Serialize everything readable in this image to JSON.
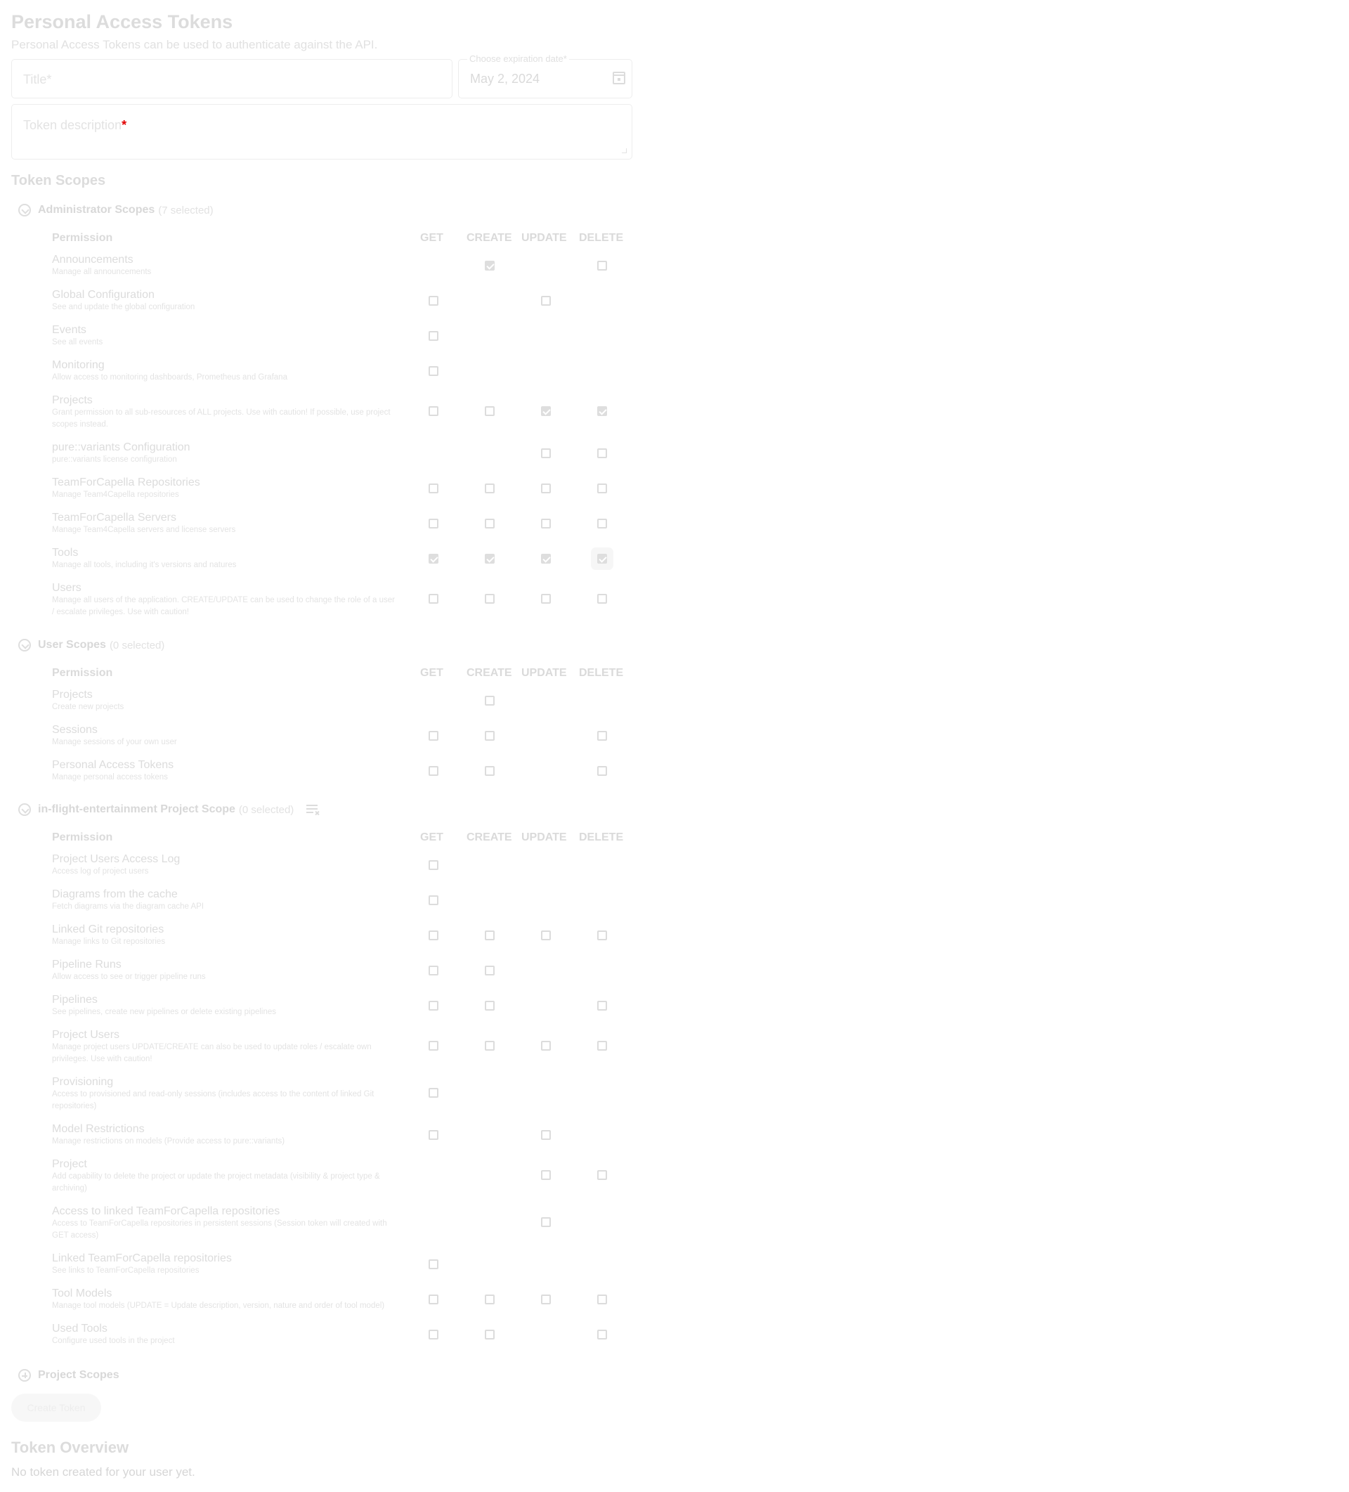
{
  "page": {
    "title": "Personal Access Tokens",
    "subtitle": "Personal Access Tokens can be used to authenticate against the API."
  },
  "form": {
    "title_placeholder": "Title*",
    "expiration_label": "Choose expiration date*",
    "expiration_value": "May 2, 2024",
    "description_placeholder": "Token description",
    "description_required_mark": "*"
  },
  "scopes": {
    "section_title": "Token Scopes",
    "columns": [
      "Permission",
      "GET",
      "CREATE",
      "UPDATE",
      "DELETE"
    ],
    "groups": [
      {
        "name": "Administrator Scopes",
        "count": "(7 selected)",
        "rows": [
          {
            "name": "Announcements",
            "desc": "Manage all announcements",
            "perms": [
              null,
              true,
              null,
              false
            ]
          },
          {
            "name": "Global Configuration",
            "desc": "See and update the global configuration",
            "perms": [
              false,
              null,
              false,
              null
            ]
          },
          {
            "name": "Events",
            "desc": "See all events",
            "perms": [
              false,
              null,
              null,
              null
            ]
          },
          {
            "name": "Monitoring",
            "desc": "Allow access to monitoring dashboards, Prometheus and Grafana",
            "perms": [
              false,
              null,
              null,
              null
            ]
          },
          {
            "name": "Projects",
            "desc": "Grant permission to all sub-resources of ALL projects. Use with caution! If possible, use project scopes instead.",
            "perms": [
              false,
              false,
              true,
              true
            ]
          },
          {
            "name": "pure::variants Configuration",
            "desc": "pure::variants license configuration",
            "perms": [
              null,
              null,
              false,
              false
            ]
          },
          {
            "name": "TeamForCapella Repositories",
            "desc": "Manage Team4Capella repositories",
            "perms": [
              false,
              false,
              false,
              false
            ]
          },
          {
            "name": "TeamForCapella Servers",
            "desc": "Manage Team4Capella servers and license servers",
            "perms": [
              false,
              false,
              false,
              false
            ]
          },
          {
            "name": "Tools",
            "desc": "Manage all tools, including it's versions and natures",
            "perms": [
              true,
              true,
              true,
              true
            ]
          },
          {
            "name": "Users",
            "desc": "Manage all users of the application. CREATE/UPDATE can be used to change the role of a user / escalate privileges. Use with caution!",
            "perms": [
              false,
              false,
              false,
              false
            ]
          }
        ]
      },
      {
        "name": "User Scopes",
        "count": "(0 selected)",
        "rows": [
          {
            "name": "Projects",
            "desc": "Create new projects",
            "perms": [
              null,
              false,
              null,
              null
            ]
          },
          {
            "name": "Sessions",
            "desc": "Manage sessions of your own user",
            "perms": [
              false,
              false,
              null,
              false
            ]
          },
          {
            "name": "Personal Access Tokens",
            "desc": "Manage personal access tokens",
            "perms": [
              false,
              false,
              null,
              false
            ]
          }
        ]
      },
      {
        "name": "in-flight-entertainment Project Scope",
        "count": "(0 selected)",
        "rows": [
          {
            "name": "Project Users Access Log",
            "desc": "Access log of project users",
            "perms": [
              false,
              null,
              null,
              null
            ]
          },
          {
            "name": "Diagrams from the cache",
            "desc": "Fetch diagrams via the diagram cache API",
            "perms": [
              false,
              null,
              null,
              null
            ]
          },
          {
            "name": "Linked Git repositories",
            "desc": "Manage links to Git repositories",
            "perms": [
              false,
              false,
              false,
              false
            ]
          },
          {
            "name": "Pipeline Runs",
            "desc": "Allow access to see or trigger pipeline runs",
            "perms": [
              false,
              false,
              null,
              null
            ]
          },
          {
            "name": "Pipelines",
            "desc": "See pipelines, create new pipelines or delete existing pipelines",
            "perms": [
              false,
              false,
              null,
              false
            ]
          },
          {
            "name": "Project Users",
            "desc": "Manage project users UPDATE/CREATE can also be used to update roles / escalate own privileges. Use with caution!",
            "perms": [
              false,
              false,
              false,
              false
            ]
          },
          {
            "name": "Provisioning",
            "desc": "Access to provisioned and read-only sessions (includes access to the content of linked Git repositories)",
            "perms": [
              false,
              null,
              null,
              null
            ]
          },
          {
            "name": "Model Restrictions",
            "desc": "Manage restrictions on models (Provide access to pure::variants)",
            "perms": [
              false,
              null,
              false,
              null
            ]
          },
          {
            "name": "Project",
            "desc": "Add capability to delete the project or update the project metadata (visibility & project type & archiving)",
            "perms": [
              null,
              null,
              false,
              false
            ]
          },
          {
            "name": "Access to linked TeamForCapella repositories",
            "desc": "Access to TeamForCapella repositories in persistent sessions (Session token will created with GET access)",
            "perms": [
              null,
              null,
              false,
              null
            ]
          },
          {
            "name": "Linked TeamForCapella repositories",
            "desc": "See links to TeamForCapella repositories",
            "perms": [
              false,
              null,
              null,
              null
            ]
          },
          {
            "name": "Tool Models",
            "desc": "Manage tool models (UPDATE = Update description, version, nature and order of tool model)",
            "perms": [
              false,
              false,
              false,
              false
            ]
          },
          {
            "name": "Used Tools",
            "desc": "Configure used tools in the project",
            "perms": [
              false,
              false,
              null,
              false
            ]
          }
        ]
      },
      {
        "name": "Project Scopes",
        "count": "",
        "rows": []
      }
    ]
  },
  "actions": {
    "create_button": "Create Token"
  },
  "overview": {
    "title": "Token Overview",
    "empty": "No token created for your user yet."
  },
  "icons": {
    "expand": "chevron-down-circle-icon",
    "collapsed": "plus-circle-icon",
    "calendar": "calendar-icon",
    "clear_selection": "clear-all-icon"
  }
}
